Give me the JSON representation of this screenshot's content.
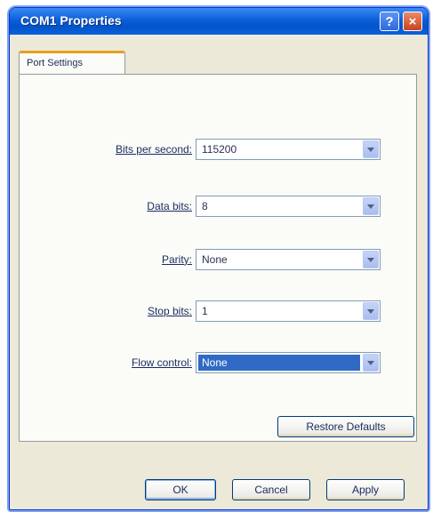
{
  "window": {
    "title": "COM1 Properties",
    "help_glyph": "?",
    "close_glyph": "×"
  },
  "tabs": [
    {
      "label": "Port Settings"
    }
  ],
  "settings": {
    "bits_per_second": {
      "label": "Bits per second:",
      "value": "115200"
    },
    "data_bits": {
      "label": "Data bits:",
      "value": "8"
    },
    "parity": {
      "label": "Parity:",
      "value": "None"
    },
    "stop_bits": {
      "label": "Stop bits:",
      "value": "1"
    },
    "flow_control": {
      "label": "Flow control:",
      "value": "None"
    }
  },
  "buttons": {
    "restore_defaults": "Restore Defaults",
    "ok": "OK",
    "cancel": "Cancel",
    "apply": "Apply"
  },
  "colors": {
    "title_bar": "#0a5fd8",
    "dialog_face": "#ece9d8",
    "selection": "#316ac5",
    "active_tab_accent": "#e7a11a"
  }
}
